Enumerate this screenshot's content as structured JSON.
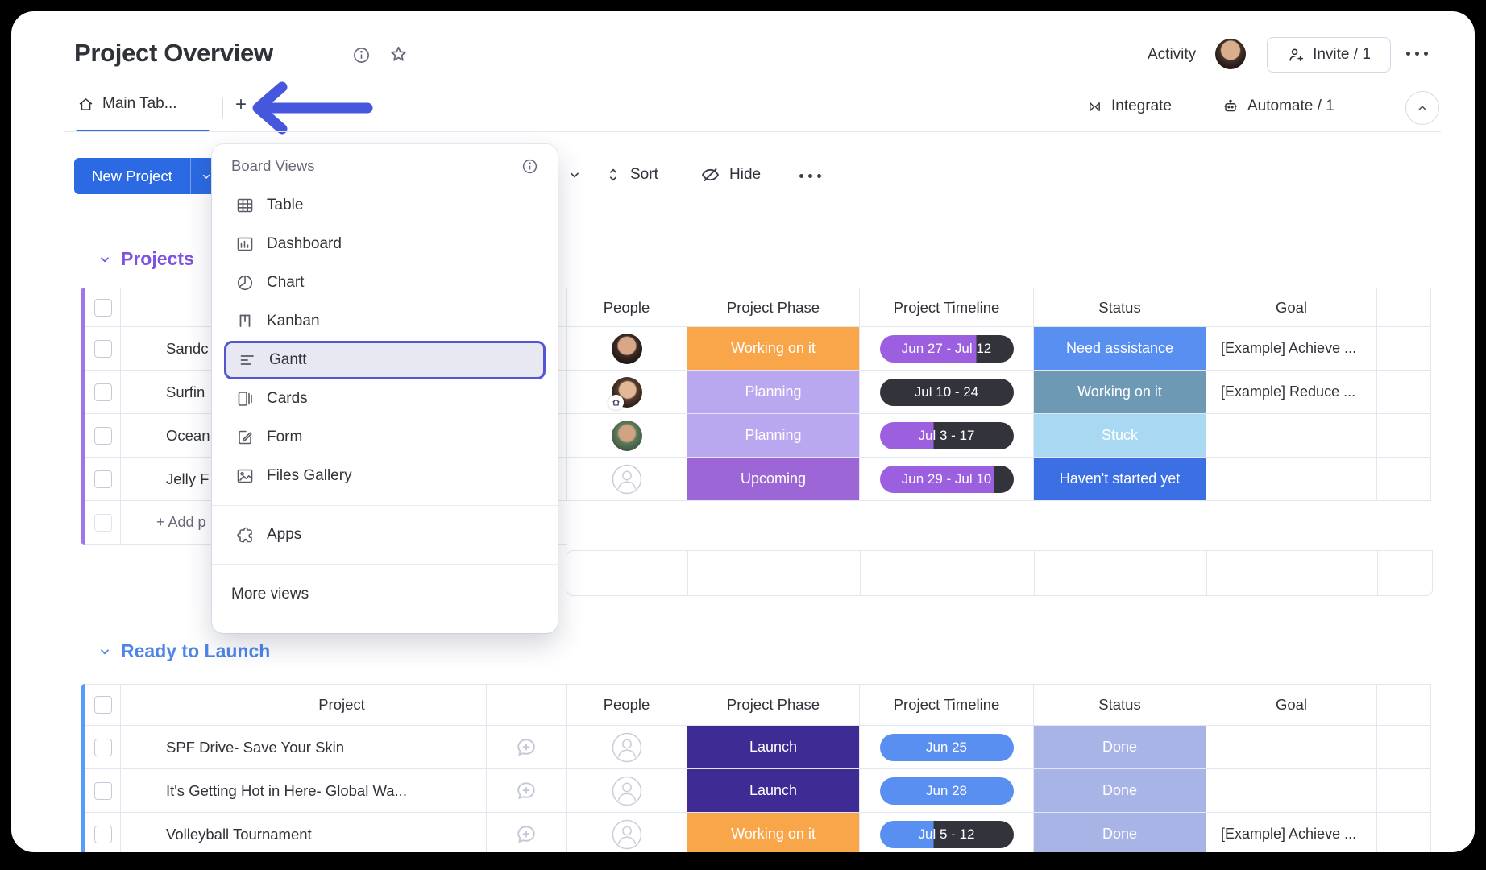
{
  "header": {
    "title": "Project Overview",
    "activity_label": "Activity",
    "invite_label": "Invite / 1"
  },
  "tabs": {
    "main_tab": "Main Tab...",
    "add_tab": "+",
    "integrate_label": "Integrate",
    "automate_label": "Automate / 1"
  },
  "toolbar": {
    "new_project_label": "New Project",
    "sort_label": "Sort",
    "hide_label": "Hide"
  },
  "menu": {
    "title": "Board Views",
    "items": [
      "Table",
      "Dashboard",
      "Chart",
      "Kanban",
      "Gantt",
      "Cards",
      "Form",
      "Files Gallery"
    ],
    "apps_label": "Apps",
    "more_label": "More views",
    "highlighted_item": "Gantt",
    "highlight_border_color": "#5356d2"
  },
  "colors": {
    "primary_button_blue": "#2b6ae3",
    "active_tab_blue": "#2c6ce2",
    "annotation_arrow_indigo": "#4656dd",
    "timeline_purple": "#9c5fe0",
    "timeline_dark": "#33343b",
    "timeline_blue": "#5a8ff2"
  },
  "groups": {
    "projects": {
      "title": "Projects",
      "title_color": "#7d53e0",
      "bar_color": "#9d78e8",
      "columns": {
        "people": "People",
        "phase": "Project Phase",
        "timeline": "Project Timeline",
        "status": "Status",
        "goal": "Goal"
      },
      "rows": [
        {
          "name": "Sandc",
          "avatar": "woman-dark-hair-photo",
          "phase": "Working on it",
          "phase_color": "#f9a64a",
          "timeline": "Jun 27 - Jul 12",
          "timeline_bg": "linear-gradient(90deg,#9c5fe0 72%,#33343b 72%)",
          "status": "Need assistance",
          "status_color": "#5a8ff2",
          "goal": "[Example] Achieve ..."
        },
        {
          "name": "Surfin",
          "avatar": "woman-home-badge-photo",
          "phase": "Planning",
          "phase_color": "#b9a7ef",
          "timeline": "Jul 10 - 24",
          "timeline_bg": "#33343b",
          "status": "Working on it",
          "status_color": "#6e99b5",
          "goal": "[Example] Reduce ..."
        },
        {
          "name": "Ocean",
          "avatar": "woman-green-photo",
          "phase": "Planning",
          "phase_color": "#b9a7ef",
          "timeline": "Jul 3 - 17",
          "timeline_bg": "linear-gradient(90deg,#9c5fe0 40%,#33343b 40%)",
          "status": "Stuck",
          "status_color": "#a9d9f2",
          "goal": ""
        },
        {
          "name": "Jelly F",
          "avatar": "empty-person",
          "phase": "Upcoming",
          "phase_color": "#9d66d6",
          "timeline": "Jun 29 - Jul 10",
          "timeline_bg": "linear-gradient(90deg,#9c5fe0 85%,#33343b 85%)",
          "status": "Haven't started yet",
          "status_color": "#3b6fe3",
          "goal": ""
        }
      ],
      "add_label": "+ Add p"
    },
    "ready": {
      "title": "Ready to Launch",
      "title_color": "#4e86e8",
      "bar_color": "#579bfc",
      "columns": {
        "project": "Project",
        "people": "People",
        "phase": "Project Phase",
        "timeline": "Project Timeline",
        "status": "Status",
        "goal": "Goal"
      },
      "rows": [
        {
          "name": "SPF Drive- Save Your Skin",
          "avatar": "empty-person",
          "phase": "Launch",
          "phase_color": "#3f2b94",
          "timeline": "Jun 25",
          "timeline_bg": "#5a8ff2",
          "status": "Done",
          "status_color": "#a9b4e6",
          "goal": ""
        },
        {
          "name": "It's Getting Hot in Here- Global Wa...",
          "avatar": "empty-person",
          "phase": "Launch",
          "phase_color": "#3f2b94",
          "timeline": "Jun 28",
          "timeline_bg": "#5a8ff2",
          "status": "Done",
          "status_color": "#a9b4e6",
          "goal": ""
        },
        {
          "name": "Volleyball Tournament",
          "avatar": "empty-person",
          "phase": "Working on it",
          "phase_color": "#f9a64a",
          "timeline": "Jul 5 - 12",
          "timeline_bg": "linear-gradient(90deg,#5a8ff2 40%,#33343b 40%)",
          "status": "Done",
          "status_color": "#a9b4e6",
          "goal": "[Example] Achieve ..."
        }
      ]
    }
  }
}
